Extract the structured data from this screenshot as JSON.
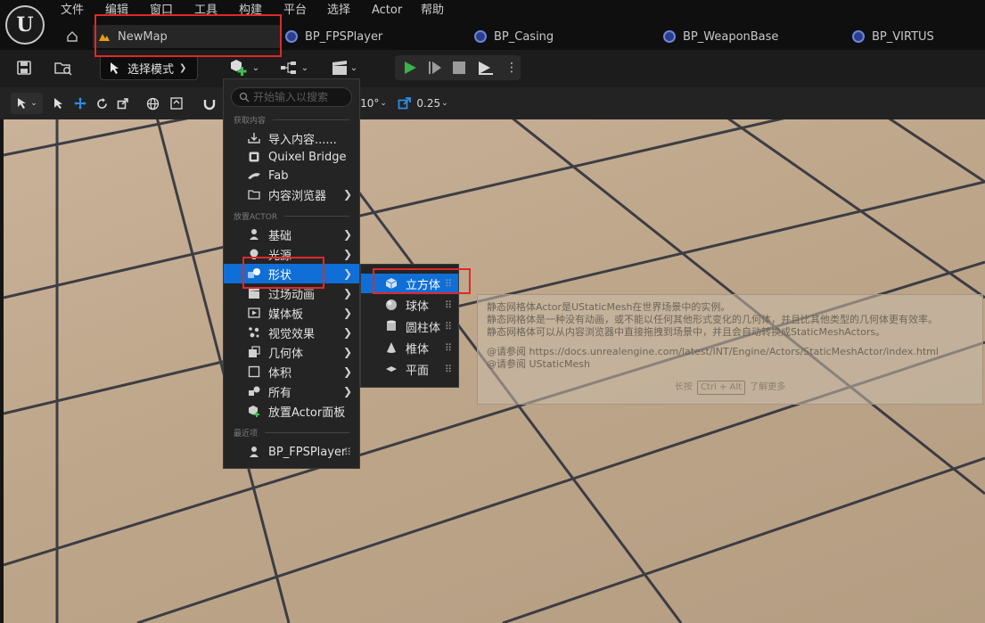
{
  "menubar": {
    "logo": "U",
    "items": [
      "文件",
      "编辑",
      "窗口",
      "工具",
      "构建",
      "平台",
      "选择",
      "Actor",
      "帮助"
    ]
  },
  "tabs": [
    {
      "label": "NewMap",
      "icon": "map-icon"
    },
    {
      "label": "BP_FPSPlayer",
      "icon": "blueprint-icon"
    },
    {
      "label": "BP_Casing",
      "icon": "blueprint-icon"
    },
    {
      "label": "BP_WeaponBase",
      "icon": "blueprint-icon"
    },
    {
      "label": "BP_VIRTUS",
      "icon": "blueprint-icon"
    }
  ],
  "toolbar": {
    "mode_label": "选择模式"
  },
  "viewport_toolbar": {
    "rotation_snap": "10°",
    "scale_snap": "0.25"
  },
  "add_menu": {
    "search_placeholder": "开始输入以搜索",
    "sections": {
      "get_content": "获取内容",
      "place_actor": "放置ACTOR",
      "recent": "最近项"
    },
    "get_content_items": [
      {
        "label": "导入内容......",
        "icon": "import-icon",
        "submenu": false
      },
      {
        "label": "Quixel Bridge",
        "icon": "bridge-icon",
        "submenu": false
      },
      {
        "label": "Fab",
        "icon": "fab-icon",
        "submenu": false
      },
      {
        "label": "内容浏览器",
        "icon": "content-browser-icon",
        "submenu": true
      }
    ],
    "place_items": [
      {
        "label": "基础",
        "icon": "basic-icon",
        "submenu": true
      },
      {
        "label": "光源",
        "icon": "light-icon",
        "submenu": true
      },
      {
        "label": "形状",
        "icon": "shapes-icon",
        "submenu": true,
        "active": true
      },
      {
        "label": "过场动画",
        "icon": "cinematic-icon",
        "submenu": true
      },
      {
        "label": "媒体板",
        "icon": "media-icon",
        "submenu": true
      },
      {
        "label": "视觉效果",
        "icon": "vfx-icon",
        "submenu": true
      },
      {
        "label": "几何体",
        "icon": "geometry-icon",
        "submenu": true
      },
      {
        "label": "体积",
        "icon": "volume-icon",
        "submenu": true
      },
      {
        "label": "所有",
        "icon": "all-icon",
        "submenu": true
      },
      {
        "label": "放置Actor面板",
        "icon": "place-actor-icon",
        "submenu": false
      }
    ],
    "recent_items": [
      {
        "label": "BP_FPSPlayer",
        "icon": "player-icon"
      }
    ]
  },
  "shapes_submenu": [
    {
      "label": "立方体",
      "icon": "cube-icon",
      "active": true
    },
    {
      "label": "球体",
      "icon": "sphere-icon"
    },
    {
      "label": "圆柱体",
      "icon": "cylinder-icon"
    },
    {
      "label": "椎体",
      "icon": "cone-icon"
    },
    {
      "label": "平面",
      "icon": "plane-icon"
    }
  ],
  "tooltip": {
    "lines": [
      "静态网格体Actor是UStaticMesh在世界场景中的实例。",
      "静态网格体是一种没有动画，或不能以任何其他形式变化的几何体，并且比其他类型的几何体更有效率。",
      "静态网格体可以从内容浏览器中直接拖拽到场景中，并且会自动转换成StaticMeshActors。"
    ],
    "links": [
      "@请参阅 https://docs.unrealengine.com/latest/INT/Engine/Actors/StaticMeshActor/index.html",
      "@请参阅 UStaticMesh"
    ],
    "hint_prefix": "长按",
    "hint_key": "Ctrl + Alt",
    "hint_suffix": "了解更多"
  }
}
